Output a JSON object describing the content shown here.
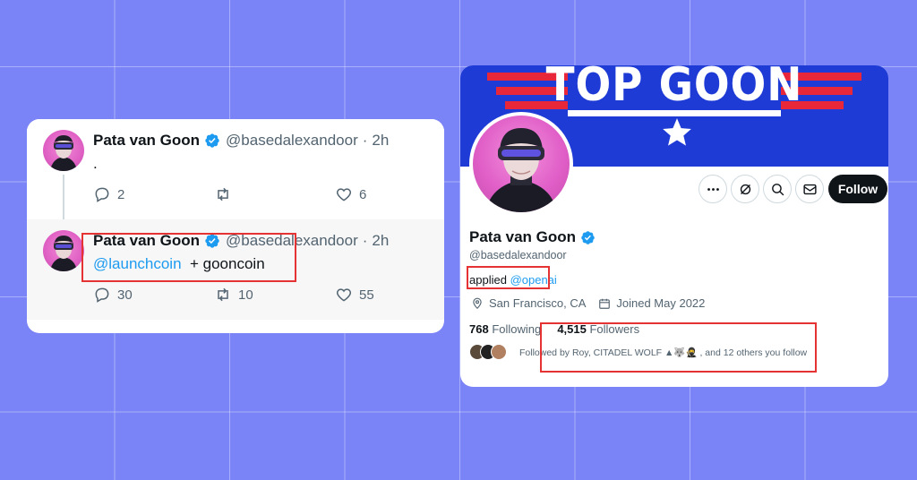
{
  "tweets": [
    {
      "name": "Pata van Goon",
      "handle": "@basedalexandoor",
      "separator": "·",
      "time": "2h",
      "text": ".",
      "replies": "2",
      "retweets": "",
      "likes": "6"
    },
    {
      "name": "Pata van Goon",
      "handle": "@basedalexandoor",
      "separator": "·",
      "time": "2h",
      "mention": "@launchcoin",
      "text_rest": "+ gooncoin",
      "replies": "30",
      "retweets": "10",
      "likes": "55"
    }
  ],
  "profile": {
    "banner_title": "TOP GOON",
    "name": "Pata van Goon",
    "handle": "@basedalexandoor",
    "bio_prefix": "applied",
    "bio_mention": "@openai",
    "location": "San Francisco, CA",
    "joined": "Joined May 2022",
    "following_count": "768",
    "following_label": "Following",
    "followers_count": "4,515",
    "followers_label": "Followers",
    "followed_by": "Followed by Roy, CITADEL WOLF ▲🐺🥷 , and 12 others you follow",
    "follow_button": "Follow"
  },
  "icons": {
    "more": "more-icon",
    "subscribe": "notification-icon",
    "search": "search-icon",
    "message": "mail-icon",
    "verified": "verified-badge-icon",
    "location": "location-icon",
    "calendar": "calendar-icon"
  },
  "colors": {
    "background": "#7b84f7",
    "link": "#1d9bf0",
    "verified": "#1d9bf0",
    "highlight": "#e53232",
    "banner": "#1e3bd6"
  }
}
